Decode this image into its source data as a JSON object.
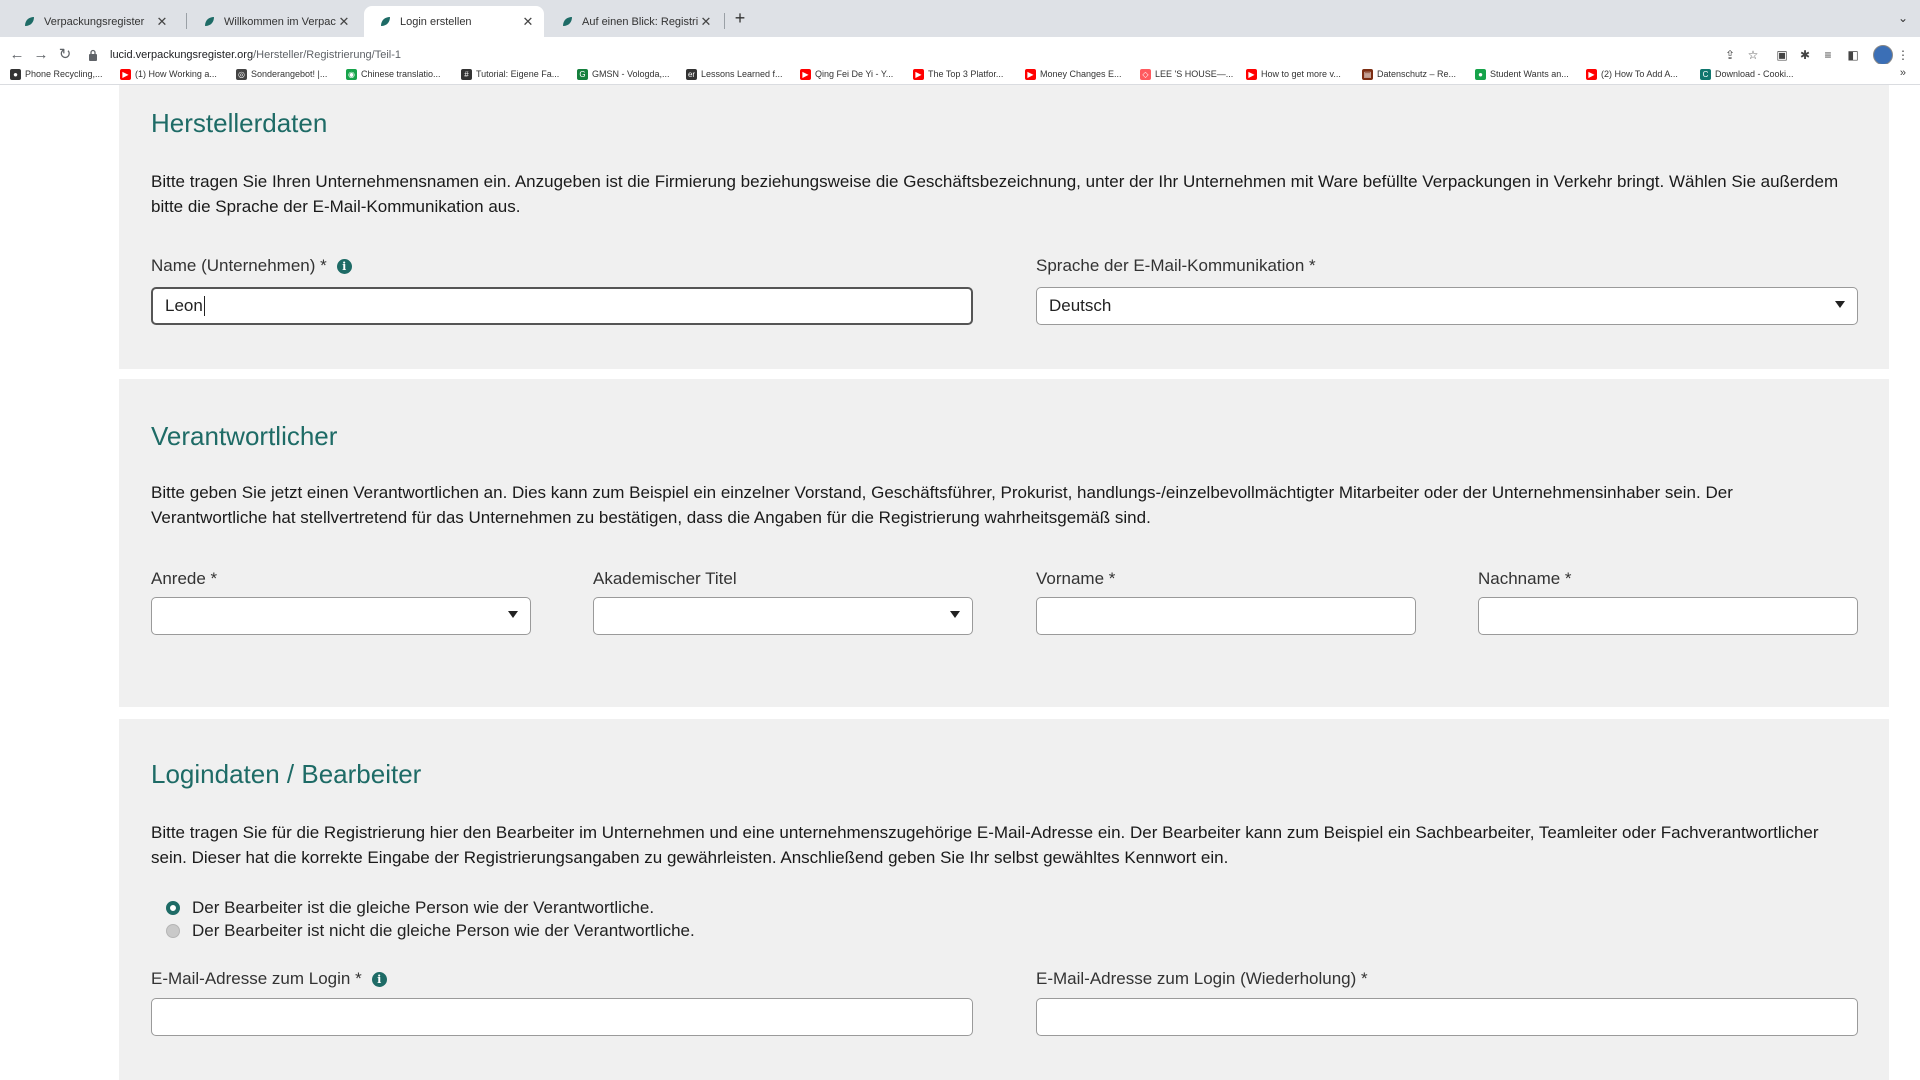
{
  "browser": {
    "tabs": [
      {
        "label": "Verpackungsregister",
        "active": false
      },
      {
        "label": "Willkommen im Verpackungsre",
        "active": false
      },
      {
        "label": "Login erstellen",
        "active": true
      },
      {
        "label": "Auf einen Blick: Registrierung",
        "active": false
      }
    ],
    "url_domain": "lucid.verpackungsregister.org",
    "url_path": "/Hersteller/Registrierung/Teil-1",
    "bookmarks": [
      {
        "label": "Phone Recycling,...",
        "icon": "circle-icon",
        "color": "#333333"
      },
      {
        "label": "(1) How Working a...",
        "icon": "youtube-icon",
        "color": "#ff0000"
      },
      {
        "label": "Sonderangebot! |...",
        "icon": "chrome-icon",
        "color": "#444444"
      },
      {
        "label": "Chinese translatio...",
        "icon": "globe-icon",
        "color": "#16a34a"
      },
      {
        "label": "Tutorial: Eigene Fa...",
        "icon": "hash-icon",
        "color": "#333333"
      },
      {
        "label": "GMSN - Vologda,...",
        "icon": "gmsn-icon",
        "color": "#15803d"
      },
      {
        "label": "Lessons Learned f...",
        "icon": "er-icon",
        "color": "#333333"
      },
      {
        "label": "Qing Fei De Yi - Y...",
        "icon": "youtube-icon",
        "color": "#ff0000"
      },
      {
        "label": "The Top 3 Platfor...",
        "icon": "youtube-icon",
        "color": "#ff0000"
      },
      {
        "label": "Money Changes E...",
        "icon": "youtube-icon",
        "color": "#ff0000"
      },
      {
        "label": "LEE 'S HOUSE—...",
        "icon": "airbnb-icon",
        "color": "#ff5a5f"
      },
      {
        "label": "How to get more v...",
        "icon": "youtube-icon",
        "color": "#ff0000"
      },
      {
        "label": "Datenschutz – Re...",
        "icon": "doc-icon",
        "color": "#7c2d12"
      },
      {
        "label": "Student Wants an...",
        "icon": "circle-icon",
        "color": "#16a34a"
      },
      {
        "label": "(2) How To Add A...",
        "icon": "youtube-icon",
        "color": "#ff0000"
      },
      {
        "label": "Download - Cooki...",
        "icon": "cookie-icon",
        "color": "#0f766e"
      }
    ]
  },
  "herstellerdaten": {
    "title": "Herstellerdaten",
    "description": "Bitte tragen Sie Ihren Unternehmensnamen ein. Anzugeben ist die Firmierung beziehungsweise die Geschäftsbezeichnung, unter der Ihr Unternehmen mit Ware befüllte Verpackungen in Verkehr bringt. Wählen Sie außerdem bitte die Sprache der E-Mail-Kommunikation aus.",
    "name_label": "Name (Unternehmen) *",
    "name_value": "Leon",
    "language_label": "Sprache der E-Mail-Kommunikation *",
    "language_value": "Deutsch"
  },
  "verantwortlicher": {
    "title": "Verantwortlicher",
    "description": "Bitte geben Sie jetzt einen Verantwortlichen an. Dies kann zum Beispiel ein einzelner Vorstand, Geschäftsführer, Prokurist, handlungs-/einzelbevollmächtigter Mitarbeiter oder der Unternehmensinhaber sein. Der Verantwortliche hat stellvertretend für das Unternehmen zu bestätigen, dass die Angaben für die Registrierung wahrheitsgemäß sind.",
    "anrede_label": "Anrede *",
    "anrede_value": "",
    "titel_label": "Akademischer Titel",
    "titel_value": "",
    "vorname_label": "Vorname *",
    "vorname_value": "",
    "nachname_label": "Nachname *",
    "nachname_value": ""
  },
  "login": {
    "title": "Logindaten / Bearbeiter",
    "description": "Bitte tragen Sie für die Registrierung hier den Bearbeiter im Unternehmen und eine unternehmenszugehörige E-Mail-Adresse ein. Der Bearbeiter kann zum Beispiel ein Sachbearbeiter, Teamleiter oder Fachverantwortlicher sein. Dieser hat die korrekte Eingabe der Registrierungsangaben zu gewährleisten. Anschließend geben Sie Ihr selbst gewähltes Kennwort ein.",
    "radio_same": "Der Bearbeiter ist die gleiche Person wie der Verantwortliche.",
    "radio_different": "Der Bearbeiter ist nicht die gleiche Person wie der Verantwortliche.",
    "selected_option": "same",
    "email_label": "E-Mail-Adresse zum Login *",
    "email_value": "",
    "email_repeat_label": "E-Mail-Adresse zum Login (Wiederholung) *",
    "email_repeat_value": ""
  },
  "colors": {
    "accent": "#1e6b66",
    "card_background": "#f0f0f0",
    "tabbar": "#dee1e6"
  }
}
